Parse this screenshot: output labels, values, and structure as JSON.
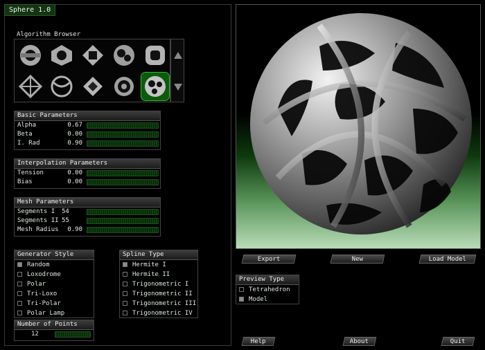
{
  "window": {
    "title": "Sphere 1.0"
  },
  "algorithm_browser": {
    "label": "Algorithm Browser",
    "thumbnail_count": 10,
    "selected_index": 9
  },
  "basic_parameters": {
    "title": "Basic Parameters",
    "rows": [
      {
        "name": "Alpha",
        "value": "0.67"
      },
      {
        "name": "Beta",
        "value": "0.00"
      },
      {
        "name": "I. Rad",
        "value": "0.90"
      }
    ]
  },
  "interpolation_parameters": {
    "title": "Interpolation Parameters",
    "rows": [
      {
        "name": "Tension",
        "value": "0.00"
      },
      {
        "name": "Bias",
        "value": "0.00"
      }
    ]
  },
  "mesh_parameters": {
    "title": "Mesh Parameters",
    "rows": [
      {
        "name": "Segments I",
        "value": "54"
      },
      {
        "name": "Segments II",
        "value": "55"
      },
      {
        "name": "Mesh Radius",
        "value": "0.90"
      }
    ]
  },
  "generator_style": {
    "title": "Generator Style",
    "options": [
      {
        "label": "Random",
        "checked": true
      },
      {
        "label": "Loxodrome",
        "checked": false
      },
      {
        "label": "Polar",
        "checked": false
      },
      {
        "label": "Tri-Loxo",
        "checked": false
      },
      {
        "label": "Tri-Polar",
        "checked": false
      },
      {
        "label": "Polar Lamp",
        "checked": false
      }
    ]
  },
  "spline_type": {
    "title": "Spline Type",
    "options": [
      {
        "label": "Hermite I",
        "checked": true
      },
      {
        "label": "Hermite II",
        "checked": false
      },
      {
        "label": "Trigonometric I",
        "checked": false
      },
      {
        "label": "Trigonometric II",
        "checked": false
      },
      {
        "label": "Trigonometric III",
        "checked": false
      },
      {
        "label": "Trigonometric IV",
        "checked": false
      }
    ]
  },
  "number_of_points": {
    "title": "Number of Points",
    "value": "12"
  },
  "actions": {
    "export": "Export",
    "new": "New",
    "load_model": "Load Model"
  },
  "preview_type": {
    "title": "Preview Type",
    "options": [
      {
        "label": "Tetrahedron",
        "checked": false
      },
      {
        "label": "Model",
        "checked": true
      }
    ]
  },
  "footer": {
    "help": "Help",
    "about": "About",
    "quit": "Quit"
  },
  "colors": {
    "accent_green": "#1f8a1f",
    "panel_border": "#444444",
    "background": "#000000"
  }
}
